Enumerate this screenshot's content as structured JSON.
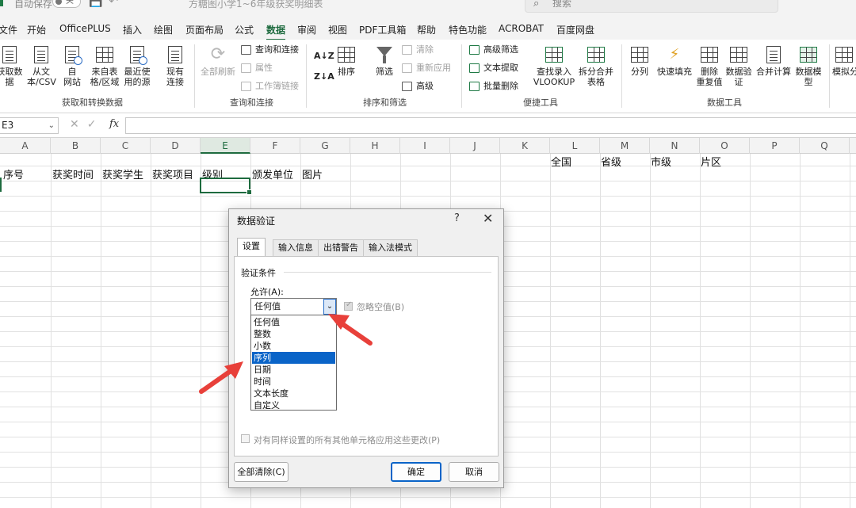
{
  "titlebar": {
    "autosave_label": "自动保存",
    "autosave_state": "关",
    "document_title": "方糖图小学1~6年级获奖明细表",
    "search_placeholder": "搜索"
  },
  "menu": {
    "tabs": [
      "文件",
      "开始",
      "OfficePLUS",
      "插入",
      "绘图",
      "页面布局",
      "公式",
      "数据",
      "审阅",
      "视图",
      "PDF工具箱",
      "帮助",
      "特色功能",
      "ACROBAT",
      "百度网盘"
    ],
    "active": "数据"
  },
  "ribbon": {
    "groups": {
      "get_transform": "获取和转换数据",
      "queries": "查询和连接",
      "sort_filter": "排序和筛选",
      "quick_tools": "便捷工具",
      "data_tools": "数据工具"
    },
    "get_data": "获取数\n据",
    "from_text": "从文\n本/CSV",
    "from_web": "自\n网站",
    "from_table": "来自表\n格/区域",
    "recent_sources": "最近使\n用的源",
    "existing_conn": "现有\n连接",
    "refresh_all": "全部刷新",
    "query_conn": "查询和连接",
    "properties": "属性",
    "edit_links": "工作簿链接",
    "sort": "排序",
    "filter": "筛选",
    "clear": "清除",
    "reapply": "重新应用",
    "advanced": "高级",
    "adv_filter": "高级筛选",
    "text_extract": "文本提取",
    "batch_delete": "批量删除",
    "lookup": "查找录入\nVLOOKUP",
    "split_merge": "拆分合并\n表格",
    "text_to_col": "分列",
    "flash_fill": "快速填充",
    "remove_dup": "删除\n重复值",
    "data_validation": "数据验\n证",
    "consolidate": "合并计算",
    "data_model": "数据模\n型",
    "what_if": "模拟分"
  },
  "formula_bar": {
    "name_box": "E3",
    "fx": "fx",
    "value": ""
  },
  "columns": [
    "A",
    "B",
    "C",
    "D",
    "E",
    "F",
    "G",
    "H",
    "I",
    "J",
    "K",
    "L",
    "M",
    "N",
    "O",
    "P",
    "Q"
  ],
  "selected_column": "E",
  "cells": {
    "row2": [
      "全国",
      "省级",
      "市级",
      "片区"
    ],
    "row3": [
      "序号",
      "获奖时间",
      "获奖学生",
      "获奖项目",
      "级别",
      "颁发单位",
      "图片"
    ]
  },
  "dialog": {
    "title": "数据验证",
    "help": "?",
    "close": "✕",
    "tabs": [
      "设置",
      "输入信息",
      "出错警告",
      "输入法模式"
    ],
    "active_tab": "设置",
    "section": "验证条件",
    "allow_label": "允许(A):",
    "allow_value": "任何值",
    "ignore_blank": "忽略空值(B)",
    "options": [
      "任何值",
      "整数",
      "小数",
      "序列",
      "日期",
      "时间",
      "文本长度",
      "自定义"
    ],
    "highlighted_option": "序列",
    "apply_all": "对有同样设置的所有其他单元格应用这些更改(P)",
    "clear_all": "全部清除(C)",
    "ok": "确定",
    "cancel": "取消"
  },
  "colors": {
    "accent_green": "#1e6b3f",
    "highlight_blue": "#0a64c8",
    "arrow_red": "#e8403a"
  }
}
